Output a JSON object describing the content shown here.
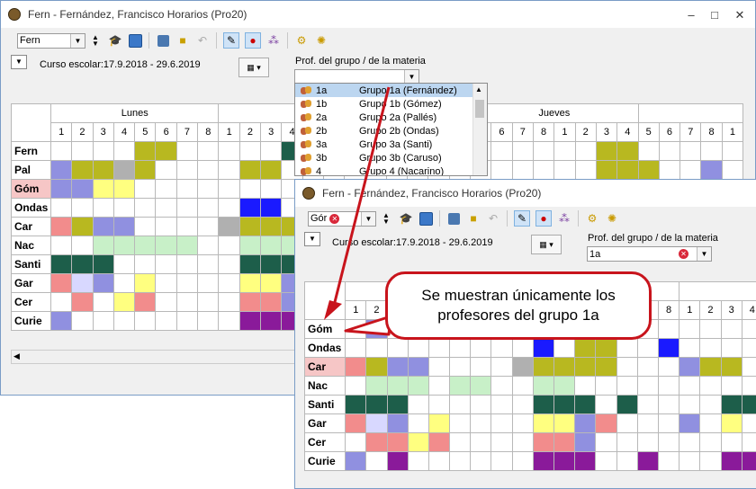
{
  "back_window": {
    "title": "Fern - Fernández, Francisco  Horarios  (Pro20)",
    "teacher_select": "Fern",
    "school_year": "Curso escolar:17.9.2018 - 29.6.2019",
    "group_label": "Prof. del grupo / de la materia",
    "group_value": "",
    "days": [
      "Lunes",
      "bles",
      "Jueves"
    ],
    "periods": [
      "1",
      "2",
      "3",
      "4",
      "5",
      "6",
      "7",
      "8"
    ],
    "teachers": [
      "Fern",
      "Pal",
      "Góm",
      "Ondas",
      "Car",
      "Nac",
      "Santi",
      "Gar",
      "Cer",
      "Curie"
    ]
  },
  "dropdown": {
    "items": [
      {
        "code": "1a",
        "name": "Grupo 1a (Fernández)"
      },
      {
        "code": "1b",
        "name": "Grupo 1b (Gómez)"
      },
      {
        "code": "2a",
        "name": "Grupo 2a (Pallés)"
      },
      {
        "code": "2b",
        "name": "Grupo 2b (Ondas)"
      },
      {
        "code": "3a",
        "name": "Grupo 3a (Santi)"
      },
      {
        "code": "3b",
        "name": "Grupo 3b (Caruso)"
      },
      {
        "code": "4",
        "name": "Grupo 4 (Nacarino)"
      }
    ]
  },
  "front_window": {
    "title": "Fern - Fernández, Francisco  Horarios  (Pro20)",
    "teacher_select": "Gór",
    "school_year": "Curso escolar:17.9.2018 - 29.6.2019",
    "group_label": "Prof. del grupo / de la materia",
    "group_value": "1a",
    "periods": [
      "1",
      "2",
      "3",
      "4",
      "5",
      "6",
      "7",
      "8"
    ],
    "teachers": [
      "Góm",
      "Ondas",
      "Car",
      "Nac",
      "Santi",
      "Gar",
      "Cer",
      "Curie"
    ]
  },
  "callout": {
    "line1": "Se muestran únicamente los",
    "line2": "profesores del grupo 1a"
  },
  "colors": {
    "window_border": "#7a9cc6",
    "callout_border": "#c8141c",
    "selected_row": "#bcd6f0"
  }
}
